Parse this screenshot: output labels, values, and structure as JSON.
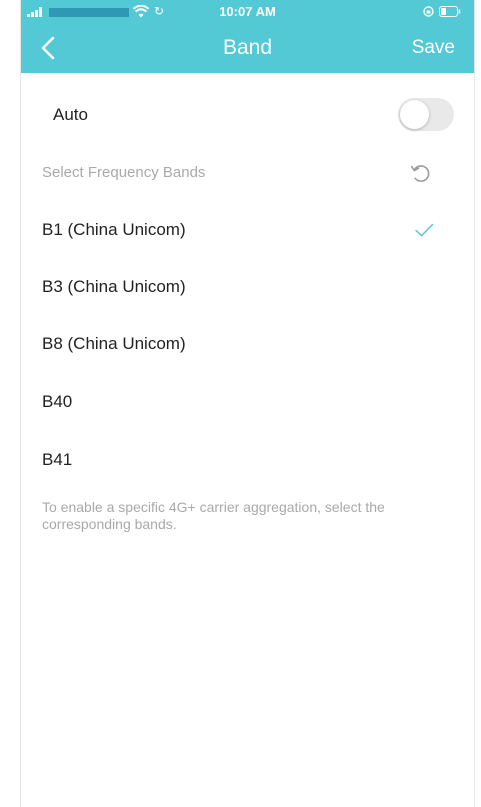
{
  "status_bar": {
    "time": "10:07 AM"
  },
  "nav": {
    "title": "Band",
    "save_label": "Save"
  },
  "auto": {
    "label": "Auto",
    "enabled": false
  },
  "frequency_section": {
    "label": "Select Frequency Bands"
  },
  "bands": [
    {
      "label": "B1 (China Unicom)",
      "selected": true
    },
    {
      "label": "B3 (China Unicom)",
      "selected": false
    },
    {
      "label": "B8 (China Unicom)",
      "selected": false
    },
    {
      "label": "B40",
      "selected": false
    },
    {
      "label": "B41",
      "selected": false
    }
  ],
  "hint": "To enable a specific 4G+ carrier aggregation, select the corresponding bands.",
  "colors": {
    "accent": "#52c9d4",
    "check": "#52c9d4",
    "muted_text": "#a9a9a9"
  },
  "icons": {
    "back": "chevron-left-icon",
    "reset": "reset-icon",
    "check": "check-icon"
  }
}
